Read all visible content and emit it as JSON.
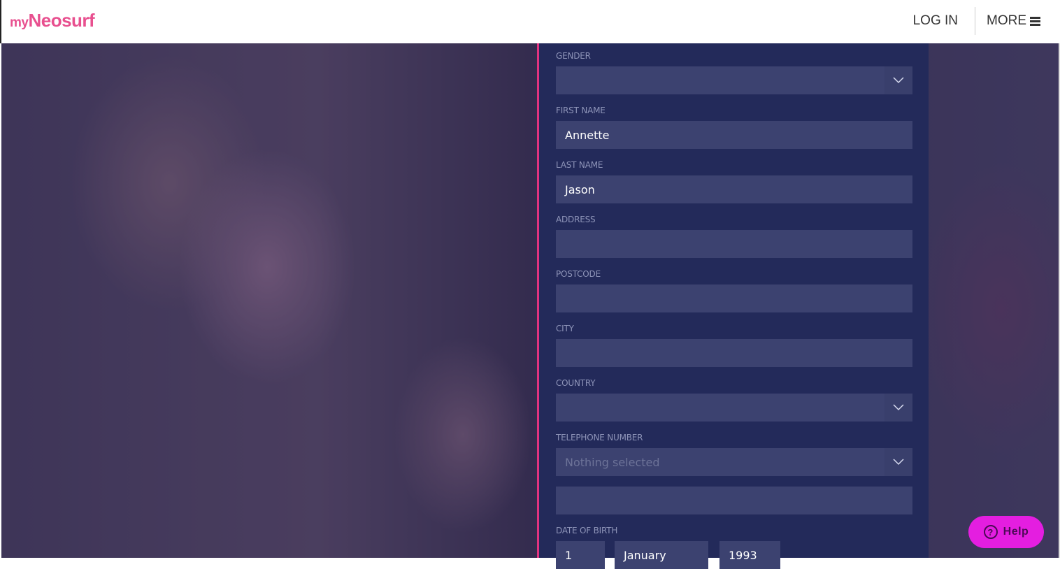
{
  "header": {
    "logo_my": "my",
    "logo_brand": "Neosurf",
    "login_label": "LOG IN",
    "more_label": "MORE"
  },
  "colors": {
    "brand": "#e8508f",
    "accent_border": "#e2337f",
    "panel": "#232a5a",
    "help": "#e41ee0"
  },
  "form": {
    "gender": {
      "label": "GENDER",
      "value": ""
    },
    "first_name": {
      "label": "FIRST NAME",
      "value": "Annette"
    },
    "last_name": {
      "label": "LAST NAME",
      "value": "Jason"
    },
    "address": {
      "label": "ADDRESS",
      "value": ""
    },
    "postcode": {
      "label": "POSTCODE",
      "value": ""
    },
    "city": {
      "label": "CITY",
      "value": ""
    },
    "country": {
      "label": "COUNTRY",
      "value": ""
    },
    "telephone": {
      "label": "TELEPHONE NUMBER",
      "prefix_placeholder": "Nothing selected",
      "value": ""
    },
    "dob": {
      "label": "DATE OF BIRTH",
      "day": "1",
      "month": "January",
      "year": "1993"
    }
  },
  "help": {
    "label": "Help",
    "icon": "question-circle-icon"
  }
}
